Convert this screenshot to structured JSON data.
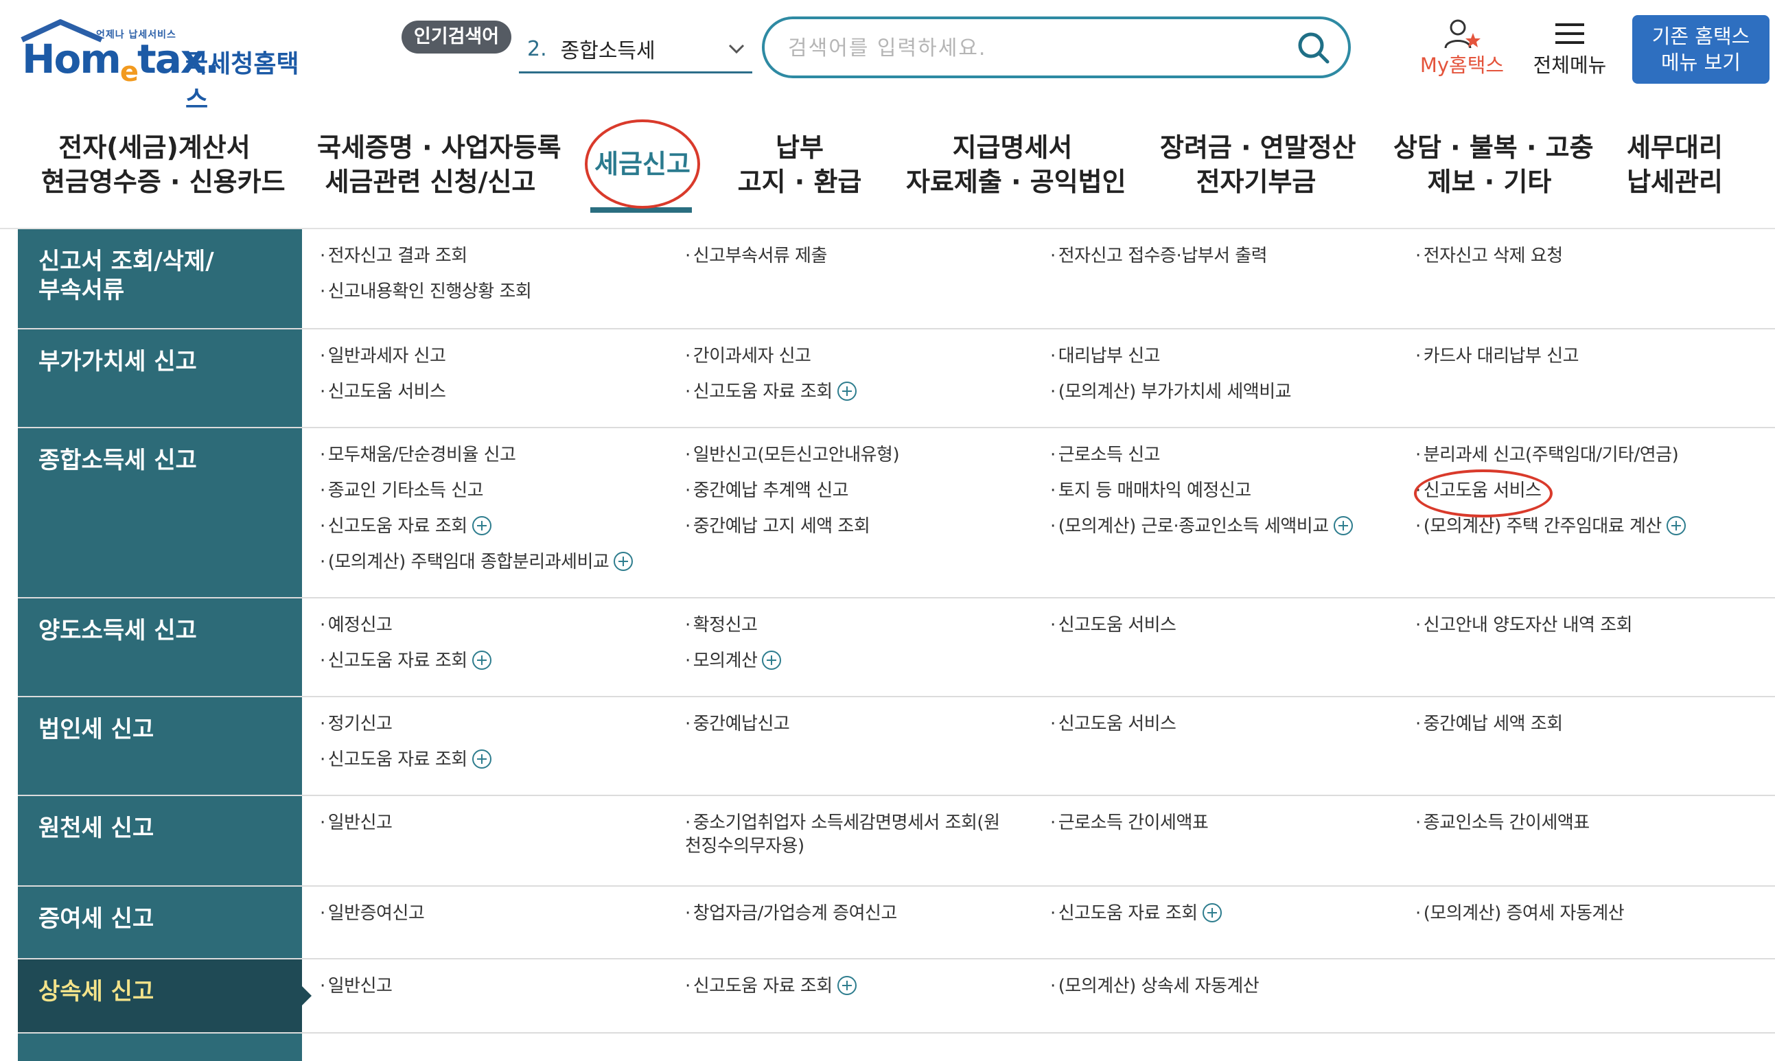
{
  "header": {
    "logo_small": "언제나 납세서비스",
    "logo_word_a": "Hom",
    "logo_word_e": "e",
    "logo_word_b": "tax.",
    "logo_sub": "국세청홈택스",
    "popular_badge": "인기검색어",
    "popular_number": "2.",
    "popular_term": "종합소득세",
    "search_placeholder": "검색어를 입력하세요.",
    "my_label": "My홈택스",
    "menu_label": "전체메뉴",
    "legacy_line1": "기존 홈택스",
    "legacy_line2": "메뉴 보기"
  },
  "colors": {
    "category_bg": "#2d6b78",
    "category_active_bg": "#1f4a55",
    "accent_red": "#d93a2b",
    "legacy_btn": "#2e6fc0"
  },
  "nav": [
    {
      "line1": "전자(세금)계산서",
      "line2": "현금영수증 · 신용카드"
    },
    {
      "line1": "국세증명 · 사업자등록",
      "line2": "세금관련 신청/신고"
    },
    {
      "line1": "세금신고",
      "line2": ""
    },
    {
      "line1": "납부",
      "line2": "고지 · 환급"
    },
    {
      "line1": "지급명세서",
      "line2": "자료제출 · 공익법인"
    },
    {
      "line1": "장려금 · 연말정산",
      "line2": "전자기부금"
    },
    {
      "line1": "상담 · 불복 · 고충",
      "line2": "제보 · 기타"
    },
    {
      "line1": "세무대리",
      "line2": "납세관리"
    }
  ],
  "rows": [
    {
      "category": "신고서 조회/삭제/부속서류",
      "cat_line1": "신고서 조회/삭제/",
      "cat_line2": "부속서류",
      "links": [
        {
          "text": "전자신고 결과 조회",
          "plus": false
        },
        {
          "text": "신고부속서류 제출",
          "plus": false
        },
        {
          "text": "전자신고 접수증·납부서 출력",
          "plus": false
        },
        {
          "text": "전자신고 삭제 요청",
          "plus": false
        },
        {
          "text": "신고내용확인 진행상황 조회",
          "plus": false
        }
      ]
    },
    {
      "category": "부가가치세 신고",
      "cat_line1": "부가가치세 신고",
      "cat_line2": "",
      "links": [
        {
          "text": "일반과세자 신고",
          "plus": false
        },
        {
          "text": "간이과세자 신고",
          "plus": false
        },
        {
          "text": "대리납부 신고",
          "plus": false
        },
        {
          "text": "카드사 대리납부 신고",
          "plus": false
        },
        {
          "text": "신고도움 서비스",
          "plus": false
        },
        {
          "text": "신고도움 자료 조회",
          "plus": true
        },
        {
          "text": "(모의계산) 부가가치세 세액비교",
          "plus": false
        }
      ]
    },
    {
      "category": "종합소득세 신고",
      "cat_line1": "종합소득세 신고",
      "cat_line2": "",
      "links": [
        {
          "text": "모두채움/단순경비율 신고",
          "plus": false
        },
        {
          "text": "일반신고(모든신고안내유형)",
          "plus": false
        },
        {
          "text": "근로소득 신고",
          "plus": false
        },
        {
          "text": "분리과세 신고(주택임대/기타/연금)",
          "plus": false
        },
        {
          "text": "종교인 기타소득 신고",
          "plus": false
        },
        {
          "text": "중간예납 추계액 신고",
          "plus": false
        },
        {
          "text": "토지 등 매매차익 예정신고",
          "plus": false
        },
        {
          "text": "신고도움 서비스",
          "plus": false
        },
        {
          "text": "신고도움 자료 조회",
          "plus": true
        },
        {
          "text": "중간예납 고지 세액 조회",
          "plus": false
        },
        {
          "text": "(모의계산) 근로·종교인소득 세액비교",
          "plus": true
        },
        {
          "text": "(모의계산) 주택 간주임대료 계산",
          "plus": true
        },
        {
          "text": "(모의계산) 주택임대 종합분리과세비교",
          "plus": true
        }
      ]
    },
    {
      "category": "양도소득세 신고",
      "cat_line1": "양도소득세 신고",
      "cat_line2": "",
      "links": [
        {
          "text": "예정신고",
          "plus": false
        },
        {
          "text": "확정신고",
          "plus": false
        },
        {
          "text": "신고도움 서비스",
          "plus": false
        },
        {
          "text": "신고안내 양도자산 내역 조회",
          "plus": false
        },
        {
          "text": "신고도움 자료 조회",
          "plus": true
        },
        {
          "text": "모의계산",
          "plus": true
        }
      ]
    },
    {
      "category": "법인세 신고",
      "cat_line1": "법인세 신고",
      "cat_line2": "",
      "links": [
        {
          "text": "정기신고",
          "plus": false
        },
        {
          "text": "중간예납신고",
          "plus": false
        },
        {
          "text": "신고도움 서비스",
          "plus": false
        },
        {
          "text": "중간예납 세액 조회",
          "plus": false
        },
        {
          "text": "신고도움 자료 조회",
          "plus": true
        }
      ]
    },
    {
      "category": "원천세 신고",
      "cat_line1": "원천세 신고",
      "cat_line2": "",
      "links": [
        {
          "text": "일반신고",
          "plus": false
        },
        {
          "text": "중소기업취업자 소득세감면명세서 조회(원천징수의무자용)",
          "plus": false
        },
        {
          "text": "근로소득 간이세액표",
          "plus": false
        },
        {
          "text": "종교인소득 간이세액표",
          "plus": false
        }
      ]
    },
    {
      "category": "증여세 신고",
      "cat_line1": "증여세 신고",
      "cat_line2": "",
      "links": [
        {
          "text": "일반증여신고",
          "plus": false
        },
        {
          "text": "창업자금/가업승계 증여신고",
          "plus": false
        },
        {
          "text": "신고도움 자료 조회",
          "plus": true
        },
        {
          "text": "(모의계산) 증여세 자동계산",
          "plus": false
        }
      ]
    },
    {
      "category": "상속세 신고",
      "cat_line1": "상속세 신고",
      "cat_line2": "",
      "links": [
        {
          "text": "일반신고",
          "plus": false
        },
        {
          "text": "신고도움 자료 조회",
          "plus": true
        },
        {
          "text": "(모의계산) 상속세 자동계산",
          "plus": false
        }
      ]
    }
  ]
}
